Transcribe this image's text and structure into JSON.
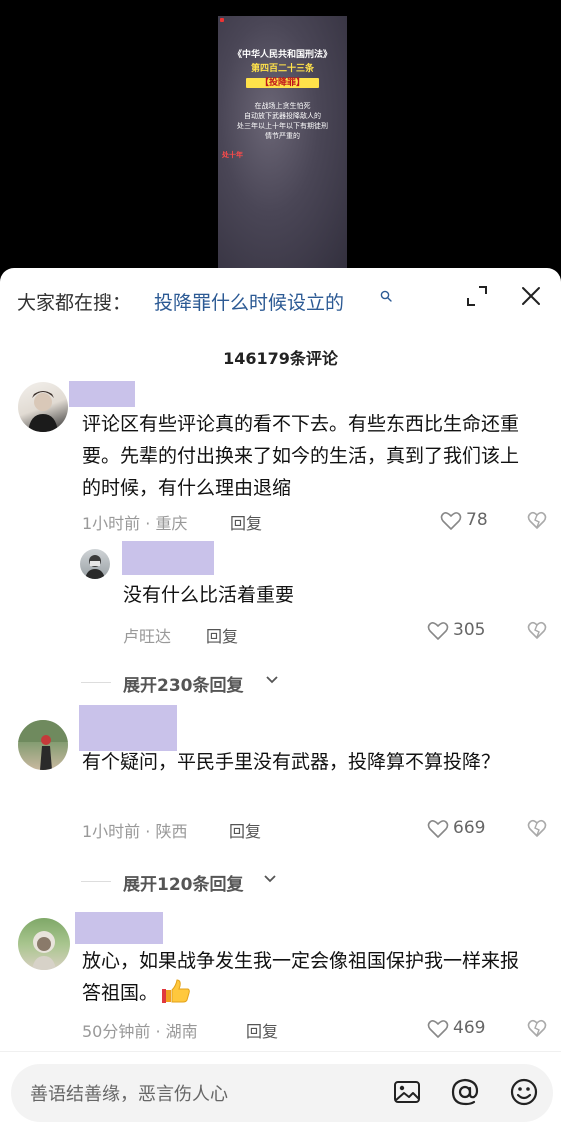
{
  "video": {
    "lines": [
      "《中华人民共和国刑法》",
      "第四百二十三条",
      "【投降罪】",
      "在战场上贪生怕死",
      "自动放下武器投降敌人的",
      "处三年以上十年以下有期徒刑",
      "情节严重的",
      "处十年"
    ]
  },
  "search": {
    "prefix": "大家都在搜：",
    "query": "投降罪什么时候设立的"
  },
  "comments_count": "146179条评论",
  "comments": [
    {
      "text": "评论区有些评论真的看不下去。有些东西比生命还重要。先辈的付出换来了如今的生活，真到了我们该上的时候，有什么理由退缩",
      "meta": "1小时前 · 重庆",
      "reply_label": "回复",
      "likes": "78",
      "reply": {
        "text": "没有什么比活着重要",
        "meta": "卢旺达",
        "reply_label": "回复",
        "likes": "305"
      },
      "expand_label": "展开230条回复"
    },
    {
      "text": "有个疑问，平民手里没有武器，投降算不算投降？",
      "meta": "1小时前 · 陕西",
      "reply_label": "回复",
      "likes": "669",
      "expand_label": "展开120条回复"
    },
    {
      "text": "放心，如果战争发生我一定会像祖国保护我一样来报答祖国。",
      "meta": "50分钟前 · 湖南",
      "reply_label": "回复",
      "likes": "469"
    }
  ],
  "input": {
    "placeholder": "善语结善缘，恶言伤人心"
  },
  "colors": {
    "name_placeholder": "#c9c2ea",
    "link_blue": "#2c5a94"
  }
}
